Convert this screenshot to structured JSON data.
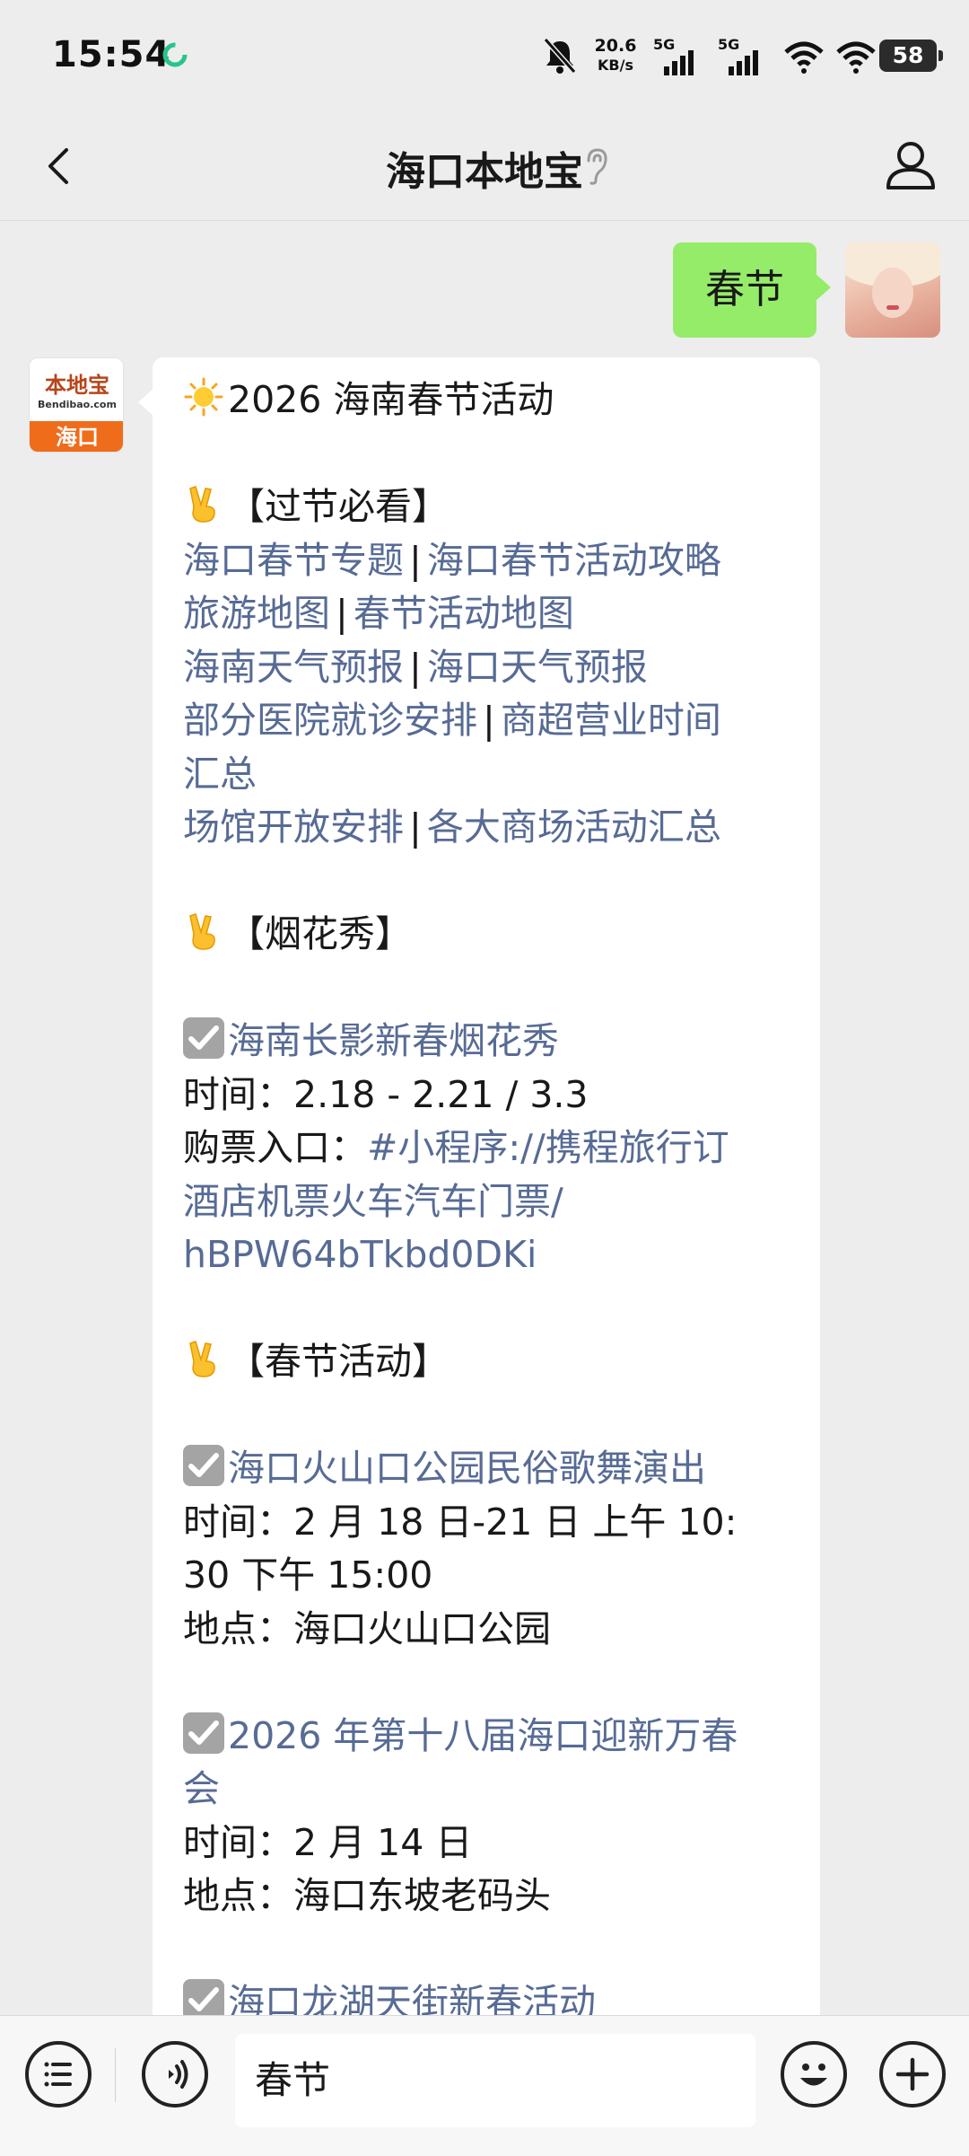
{
  "status_bar": {
    "time": "15:54",
    "net_speed_value": "20.6",
    "net_speed_unit": "KB/s",
    "sim1_label": "5G",
    "sim2_label": "5G",
    "battery": "58"
  },
  "nav": {
    "title": "海口本地宝"
  },
  "sent_message": {
    "text": "春节"
  },
  "bot_avatar": {
    "logo_main": "本地宝",
    "logo_sub": "Bendibao.com",
    "city": "海口"
  },
  "reply": {
    "title": "2026 海南春节活动",
    "section_1": "【过节必看】",
    "links_row_1": [
      "海口春节专题",
      "海口春节活动攻略"
    ],
    "links_row_2": [
      "旅游地图",
      "春节活动地图"
    ],
    "links_row_3": [
      "海南天气预报",
      "海口天气预报"
    ],
    "links_row_4a": "部分医院就诊安排",
    "links_row_4b_line1": "商超营业时间",
    "links_row_4b_line2": "汇总",
    "links_row_5": [
      "场馆开放安排",
      "各大商场活动汇总"
    ],
    "separator": "|",
    "section_2": "【烟花秀】",
    "event_1_title": "海南长影新春烟花秀",
    "event_1_time": "时间：2.18 - 2.21 / 3.3",
    "event_1_ticket_label": "购票入口：",
    "event_1_ticket_line1": "#小程序://携程旅行订",
    "event_1_ticket_line2": "酒店机票火车汽车门票/",
    "event_1_ticket_line3": "hBPW64bTkbd0DKi",
    "section_3": "【春节活动】",
    "event_2_title": "海口火山口公园民俗歌舞演出",
    "event_2_time_line1": "时间：2 月 18 日-21 日 上午 10:",
    "event_2_time_line2": "30  下午 15:00",
    "event_2_place": "地点：海口火山口公园",
    "event_3_title_line1": "2026 年第十八届海口迎新万春",
    "event_3_title_line2": "会",
    "event_3_time": "时间：2 月 14 日",
    "event_3_place": "地点：海口东坡老码头",
    "event_4_title": "海口龙湖天街新春活动"
  },
  "input_bar": {
    "text_value": "春节"
  },
  "icons": {
    "back": "chevron-left-icon",
    "profile": "person-icon",
    "ear": "ear-icon",
    "menu": "list-icon",
    "voice": "voice-icon",
    "emoji": "smiley-icon",
    "plus": "plus-icon",
    "sun": "sun-emoji",
    "victory": "victory-hand-emoji",
    "check": "check-box-emoji"
  },
  "colors": {
    "link": "#576b95",
    "sent_bubble": "#95ec69",
    "background": "#ededed"
  }
}
